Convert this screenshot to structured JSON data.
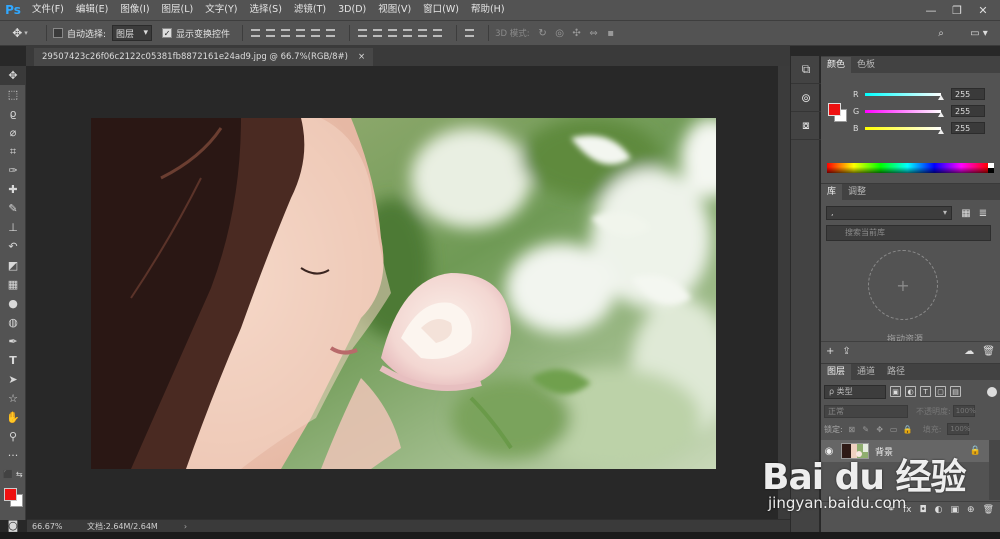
{
  "app": {
    "logo": "Ps",
    "menu": [
      "文件(F)",
      "编辑(E)",
      "图像(I)",
      "图层(L)",
      "文字(Y)",
      "选择(S)",
      "滤镜(T)",
      "3D(D)",
      "视图(V)",
      "窗口(W)",
      "帮助(H)"
    ],
    "window_controls": [
      "—",
      "❐",
      "✕"
    ]
  },
  "options_bar": {
    "auto_select_label": "自动选择:",
    "auto_select_checked": false,
    "auto_select_value": "图层",
    "show_transform_label": "显示变换控件",
    "show_transform_checked": true,
    "mode_3d_label": "3D 模式:"
  },
  "document": {
    "tab_title": "29507423c26f06c2122c05381fb8872161e24ad9.jpg @ 66.7%(RGB/8#)",
    "tab_close": "×",
    "zoom": "66.67%",
    "doc_size": "文档:2.64M/2.64M",
    "status_arrow": "›"
  },
  "colors": {
    "foreground": "#ee1111",
    "background": "#ffffff",
    "accent": "#31a8ff"
  },
  "color_panel": {
    "tabs": [
      "颜色",
      "色板"
    ],
    "channels": [
      {
        "label": "R",
        "value": "255",
        "level": 1.0,
        "gradient": "#00ffff,#ffffff"
      },
      {
        "label": "G",
        "value": "255",
        "level": 1.0,
        "gradient": "#ff00ff,#ffffff"
      },
      {
        "label": "B",
        "value": "255",
        "level": 1.0,
        "gradient": "#ffff00,#ffffff"
      }
    ],
    "menu_icon": "≡"
  },
  "library_panel": {
    "tabs": [
      "库",
      "调整"
    ],
    "select_value": ",",
    "search_placeholder": "搜索当前库",
    "drop_hint": "拖动资源",
    "plus": "+"
  },
  "layers_panel": {
    "tabs": [
      "图层",
      "通道",
      "路径"
    ],
    "filter_value": "ρ 类型",
    "blend_mode": "正常",
    "opacity_label": "不透明度:",
    "opacity_value": "100%",
    "lock_label": "锁定:",
    "fill_label": "填充:",
    "fill_value": "100%",
    "layer_name": "背景",
    "footer_icons": [
      "⚭",
      "fx",
      "◘",
      "◐",
      "▣",
      "⊕",
      "🗑"
    ]
  },
  "watermark": {
    "brand": "Bai du 经验",
    "url": "jingyan.baidu.com"
  }
}
